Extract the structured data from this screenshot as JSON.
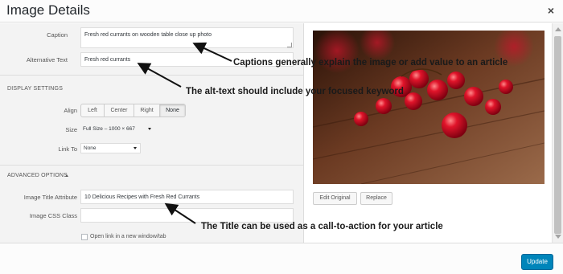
{
  "header": {
    "title": "Image Details",
    "close_icon": "close-icon",
    "close_glyph": "×"
  },
  "fields": {
    "caption_label": "Caption",
    "caption_value": "Fresh red currants on wooden table close up photo",
    "alt_label": "Alternative Text",
    "alt_value": "Fresh red currants"
  },
  "display_settings": {
    "title": "DISPLAY SETTINGS",
    "align_label": "Align",
    "align_options": [
      "Left",
      "Center",
      "Right",
      "None"
    ],
    "align_selected": "None",
    "size_label": "Size",
    "size_value": "Full Size – 1000 × 667",
    "link_label": "Link To",
    "link_value": "None"
  },
  "advanced_options": {
    "title": "ADVANCED OPTIONS",
    "title_attr_label": "Image Title Attribute",
    "title_attr_value": "10 Delicious Recipes with Fresh Red Currants",
    "css_class_label": "Image CSS Class",
    "css_class_value": "",
    "new_window_label": "Open link in a new window/tab",
    "new_window_checked": false
  },
  "preview": {
    "edit_original_label": "Edit Original",
    "replace_label": "Replace"
  },
  "annotations": {
    "caption_note": "Captions generally explain the image or add value to an article",
    "alt_note": "The alt-text should include your focused keyword",
    "title_note": "The Title can be used as a call-to-action for your article"
  },
  "footer": {
    "update_label": "Update"
  },
  "colors": {
    "primary_button": "#0085ba",
    "panel_background": "#f3f3f3",
    "berry_red": "#c8102e",
    "wood_brown": "#6b3a22"
  }
}
